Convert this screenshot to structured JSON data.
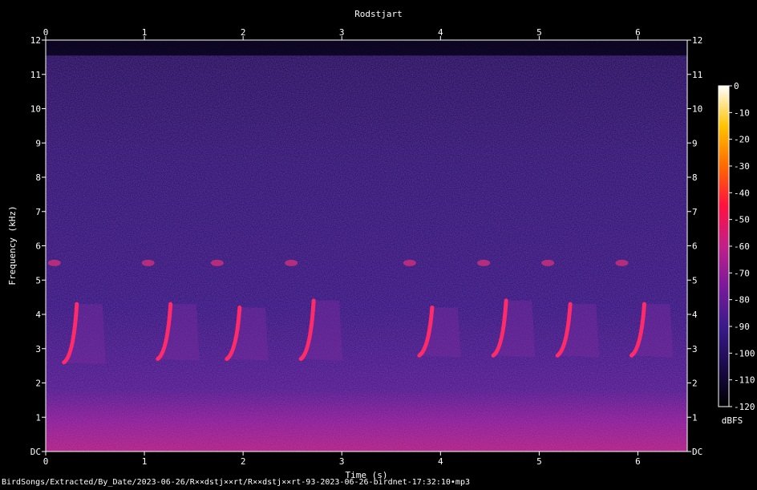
{
  "chart_data": {
    "type": "heatmap",
    "title": "Rodstjart",
    "xlabel": "Time (s)",
    "ylabel": "Frequency (kHz)",
    "xlim": [
      0,
      6.5
    ],
    "ylim": [
      0,
      12
    ],
    "x_ticks": [
      "0",
      "1",
      "2",
      "3",
      "4",
      "5",
      "6"
    ],
    "y_ticks": [
      "DC",
      "1",
      "2",
      "3",
      "4",
      "5",
      "6",
      "7",
      "8",
      "9",
      "10",
      "11",
      "12"
    ],
    "colorbar": {
      "label": "dBFS",
      "range": [
        -120,
        0
      ],
      "ticks": [
        "0",
        "-10",
        "-20",
        "-30",
        "-40",
        "-50",
        "-60",
        "-70",
        "-80",
        "-90",
        "-100",
        "-110",
        "-120"
      ],
      "colors": [
        "#000000",
        "#1a0a4a",
        "#3a1a8a",
        "#7a1a9a",
        "#c0208a",
        "#ff1040",
        "#ff6a00",
        "#ffc400",
        "#ffffff"
      ]
    },
    "song_phrases": [
      {
        "t": 0.25,
        "f_low": 2.6,
        "f_high": 4.3
      },
      {
        "t": 1.2,
        "f_low": 2.7,
        "f_high": 4.3
      },
      {
        "t": 1.9,
        "f_low": 2.7,
        "f_high": 4.2
      },
      {
        "t": 2.65,
        "f_low": 2.7,
        "f_high": 4.4
      },
      {
        "t": 3.85,
        "f_low": 2.8,
        "f_high": 4.2
      },
      {
        "t": 4.6,
        "f_low": 2.8,
        "f_high": 4.4
      },
      {
        "t": 5.25,
        "f_low": 2.8,
        "f_high": 4.3
      },
      {
        "t": 6.0,
        "f_low": 2.8,
        "f_high": 4.3
      }
    ]
  },
  "caption": "BirdSongs/Extracted/By_Date/2023-06-26/R××dstj××rt/R××dstj××rt-93-2023-06-26-birdnet-17:32:10•mp3"
}
